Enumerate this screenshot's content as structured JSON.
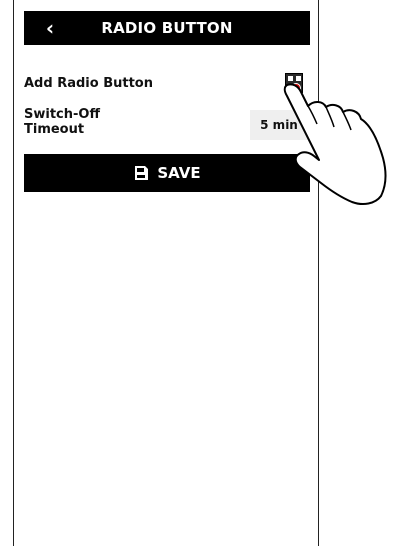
{
  "header": {
    "back_glyph": "‹",
    "title": "RADIO BUTTON"
  },
  "settings": {
    "radio_label": "Add Radio Button",
    "timeout_label": "Switch-Off Timeout",
    "timeout_value": "5 min"
  },
  "actions": {
    "save_label": "SAVE"
  },
  "icons": {
    "back": "chevron-left-icon",
    "add": "qr-code-icon",
    "save": "floppy-disk-icon",
    "pointer": "hand-pointer-icon"
  },
  "colors": {
    "header_bg": "#000000",
    "button_bg": "#000000",
    "value_bg": "#efefef",
    "accent": "#d60000"
  }
}
